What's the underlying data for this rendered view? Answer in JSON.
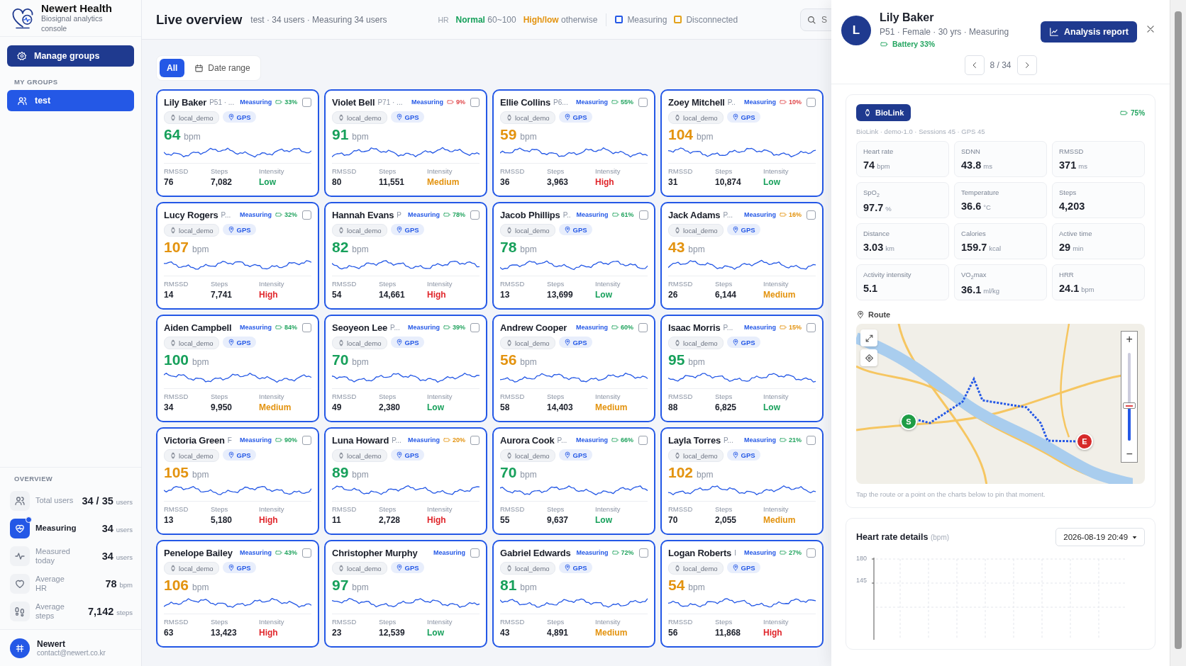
{
  "app": {
    "title": "Newert Health",
    "subtitle": "Biosignal analytics console"
  },
  "sidebar": {
    "manage_button": "Manage groups",
    "groups_heading": "MY GROUPS",
    "groups": [
      {
        "label": "test",
        "selected": true
      }
    ],
    "overview_heading": "OVERVIEW",
    "overview": [
      {
        "kind": "users",
        "label": "Total users",
        "value": "34 / 35",
        "unit": "users",
        "selected": false
      },
      {
        "kind": "measuring",
        "label": "Measuring",
        "value": "34",
        "unit": "users",
        "selected": true
      },
      {
        "kind": "pulse",
        "label": "Measured today",
        "value": "34",
        "unit": "users",
        "selected": false
      },
      {
        "kind": "heart",
        "label": "Average HR",
        "value": "78",
        "unit": "bpm",
        "selected": false
      },
      {
        "kind": "steps",
        "label": "Average steps",
        "value": "7,142",
        "unit": "steps",
        "selected": false
      }
    ],
    "account": {
      "name": "Newert",
      "email": "contact@newert.co.kr"
    }
  },
  "header": {
    "title": "Live overview",
    "summary": "test · 34 users · Measuring 34 users",
    "legend_label": "HR",
    "normal_label": "Normal",
    "normal_range": "60~100",
    "abnormal_label": "High/low",
    "abnormal_range": "otherwise",
    "status_legend": [
      {
        "label": "Measuring",
        "color": "#2458e6"
      },
      {
        "label": "Disconnected",
        "color": "#e3a21a"
      }
    ],
    "search": {
      "placeholder": "S"
    }
  },
  "filters": [
    {
      "kind": "all",
      "label": "All",
      "selected": true
    },
    {
      "kind": "date",
      "label": "Date range",
      "selected": false
    }
  ],
  "cards": [
    {
      "name": "Lily Baker",
      "meta": "P51 · ...",
      "status": "Measuring",
      "disconnected": false,
      "battery": {
        "label": "33%",
        "color": "#22a45f"
      },
      "checked": false,
      "device": "local_demo",
      "gps": "GPS",
      "bpm": "64",
      "bpm_unit": "bpm",
      "bpm_normal": true,
      "rmssd_label": "RMSSD",
      "rmssd": "76",
      "steps_label": "Steps",
      "steps": "7,082",
      "intensity_label": "Intensity",
      "intensity": {
        "label": "Low",
        "color": "#17a05b"
      }
    },
    {
      "name": "Violet Bell",
      "meta": "P71 · ...",
      "status": "Measuring",
      "disconnected": false,
      "battery": {
        "label": "9%",
        "color": "#e0474a"
      },
      "checked": false,
      "device": "local_demo",
      "gps": "GPS",
      "bpm": "91",
      "bpm_unit": "bpm",
      "bpm_normal": true,
      "rmssd_label": "RMSSD",
      "rmssd": "80",
      "steps_label": "Steps",
      "steps": "11,551",
      "intensity_label": "Intensity",
      "intensity": {
        "label": "Medium",
        "color": "#e3930f"
      }
    },
    {
      "name": "Ellie Collins",
      "meta": "P6...",
      "status": "Measuring",
      "disconnected": false,
      "battery": {
        "label": "55%",
        "color": "#22a45f"
      },
      "checked": false,
      "device": "local_demo",
      "gps": "GPS",
      "bpm": "59",
      "bpm_unit": "bpm",
      "bpm_normal": false,
      "rmssd_label": "RMSSD",
      "rmssd": "36",
      "steps_label": "Steps",
      "steps": "3,963",
      "intensity_label": "Intensity",
      "intensity": {
        "label": "High",
        "color": "#e0262b"
      }
    },
    {
      "name": "Zoey Mitchell",
      "meta": "P..",
      "status": "Measuring",
      "disconnected": false,
      "battery": {
        "label": "10%",
        "color": "#e0474a"
      },
      "checked": false,
      "device": "local_demo",
      "gps": "GPS",
      "bpm": "104",
      "bpm_unit": "bpm",
      "bpm_normal": false,
      "rmssd_label": "RMSSD",
      "rmssd": "31",
      "steps_label": "Steps",
      "steps": "10,874",
      "intensity_label": "Intensity",
      "intensity": {
        "label": "Low",
        "color": "#17a05b"
      }
    },
    {
      "name": "Lucy Rogers",
      "meta": "P...",
      "status": "Measuring",
      "disconnected": false,
      "battery": {
        "label": "32%",
        "color": "#22a45f"
      },
      "checked": false,
      "device": "local_demo",
      "gps": "GPS",
      "bpm": "107",
      "bpm_unit": "bpm",
      "bpm_normal": false,
      "rmssd_label": "RMSSD",
      "rmssd": "14",
      "steps_label": "Steps",
      "steps": "7,741",
      "intensity_label": "Intensity",
      "intensity": {
        "label": "High",
        "color": "#e0262b"
      }
    },
    {
      "name": "Hannah Evans",
      "meta": "P",
      "status": "Measuring",
      "disconnected": false,
      "battery": {
        "label": "78%",
        "color": "#22a45f"
      },
      "checked": false,
      "device": "local_demo",
      "gps": "GPS",
      "bpm": "82",
      "bpm_unit": "bpm",
      "bpm_normal": true,
      "rmssd_label": "RMSSD",
      "rmssd": "54",
      "steps_label": "Steps",
      "steps": "14,661",
      "intensity_label": "Intensity",
      "intensity": {
        "label": "High",
        "color": "#e0262b"
      }
    },
    {
      "name": "Jacob Phillips",
      "meta": "P..",
      "status": "Measuring",
      "disconnected": false,
      "battery": {
        "label": "61%",
        "color": "#22a45f"
      },
      "checked": false,
      "device": "local_demo",
      "gps": "GPS",
      "bpm": "78",
      "bpm_unit": "bpm",
      "bpm_normal": true,
      "rmssd_label": "RMSSD",
      "rmssd": "13",
      "steps_label": "Steps",
      "steps": "13,699",
      "intensity_label": "Intensity",
      "intensity": {
        "label": "Low",
        "color": "#17a05b"
      }
    },
    {
      "name": "Jack Adams",
      "meta": "P...",
      "status": "Measuring",
      "disconnected": false,
      "battery": {
        "label": "16%",
        "color": "#e3930f"
      },
      "checked": false,
      "device": "local_demo",
      "gps": "GPS",
      "bpm": "43",
      "bpm_unit": "bpm",
      "bpm_normal": false,
      "rmssd_label": "RMSSD",
      "rmssd": "26",
      "steps_label": "Steps",
      "steps": "6,144",
      "intensity_label": "Intensity",
      "intensity": {
        "label": "Medium",
        "color": "#e3930f"
      }
    },
    {
      "name": "Aiden Campbell",
      "status": "Measuring",
      "disconnected": false,
      "battery": {
        "label": "84%",
        "color": "#22a45f"
      },
      "checked": false,
      "device": "local_demo",
      "gps": "GPS",
      "bpm": "100",
      "bpm_unit": "bpm",
      "bpm_normal": true,
      "rmssd_label": "RMSSD",
      "rmssd": "34",
      "steps_label": "Steps",
      "steps": "9,950",
      "intensity_label": "Intensity",
      "intensity": {
        "label": "Medium",
        "color": "#e3930f"
      }
    },
    {
      "name": "Seoyeon Lee",
      "meta": "P...",
      "status": "Measuring",
      "disconnected": false,
      "battery": {
        "label": "39%",
        "color": "#22a45f"
      },
      "checked": false,
      "device": "local_demo",
      "gps": "GPS",
      "bpm": "70",
      "bpm_unit": "bpm",
      "bpm_normal": true,
      "rmssd_label": "RMSSD",
      "rmssd": "49",
      "steps_label": "Steps",
      "steps": "2,380",
      "intensity_label": "Intensity",
      "intensity": {
        "label": "Low",
        "color": "#17a05b"
      }
    },
    {
      "name": "Andrew Cooper",
      "status": "Measuring",
      "disconnected": false,
      "battery": {
        "label": "60%",
        "color": "#22a45f"
      },
      "checked": false,
      "device": "local_demo",
      "gps": "GPS",
      "bpm": "56",
      "bpm_unit": "bpm",
      "bpm_normal": false,
      "rmssd_label": "RMSSD",
      "rmssd": "58",
      "steps_label": "Steps",
      "steps": "14,403",
      "intensity_label": "Intensity",
      "intensity": {
        "label": "Medium",
        "color": "#e3930f"
      }
    },
    {
      "name": "Isaac Morris",
      "meta": "P...",
      "status": "Measuring",
      "disconnected": false,
      "battery": {
        "label": "15%",
        "color": "#e3930f"
      },
      "checked": false,
      "device": "local_demo",
      "gps": "GPS",
      "bpm": "95",
      "bpm_unit": "bpm",
      "bpm_normal": true,
      "rmssd_label": "RMSSD",
      "rmssd": "88",
      "steps_label": "Steps",
      "steps": "6,825",
      "intensity_label": "Intensity",
      "intensity": {
        "label": "Low",
        "color": "#17a05b"
      }
    },
    {
      "name": "Victoria Green",
      "meta": "F",
      "status": "Measuring",
      "disconnected": false,
      "battery": {
        "label": "90%",
        "color": "#22a45f"
      },
      "checked": false,
      "device": "local_demo",
      "gps": "GPS",
      "bpm": "105",
      "bpm_unit": "bpm",
      "bpm_normal": false,
      "rmssd_label": "RMSSD",
      "rmssd": "13",
      "steps_label": "Steps",
      "steps": "5,180",
      "intensity_label": "Intensity",
      "intensity": {
        "label": "High",
        "color": "#e0262b"
      }
    },
    {
      "name": "Luna Howard",
      "meta": "P...",
      "status": "Measuring",
      "disconnected": false,
      "battery": {
        "label": "20%",
        "color": "#e3930f"
      },
      "checked": false,
      "device": "local_demo",
      "gps": "GPS",
      "bpm": "89",
      "bpm_unit": "bpm",
      "bpm_normal": true,
      "rmssd_label": "RMSSD",
      "rmssd": "11",
      "steps_label": "Steps",
      "steps": "2,728",
      "intensity_label": "Intensity",
      "intensity": {
        "label": "High",
        "color": "#e0262b"
      }
    },
    {
      "name": "Aurora Cook",
      "meta": "P...",
      "status": "Measuring",
      "disconnected": false,
      "battery": {
        "label": "66%",
        "color": "#22a45f"
      },
      "checked": false,
      "device": "local_demo",
      "gps": "GPS",
      "bpm": "70",
      "bpm_unit": "bpm",
      "bpm_normal": true,
      "rmssd_label": "RMSSD",
      "rmssd": "55",
      "steps_label": "Steps",
      "steps": "9,637",
      "intensity_label": "Intensity",
      "intensity": {
        "label": "Low",
        "color": "#17a05b"
      }
    },
    {
      "name": "Layla Torres",
      "meta": "P...",
      "status": "Measuring",
      "disconnected": false,
      "battery": {
        "label": "21%",
        "color": "#22a45f"
      },
      "checked": false,
      "device": "local_demo",
      "gps": "GPS",
      "bpm": "102",
      "bpm_unit": "bpm",
      "bpm_normal": false,
      "rmssd_label": "RMSSD",
      "rmssd": "70",
      "steps_label": "Steps",
      "steps": "2,055",
      "intensity_label": "Intensity",
      "intensity": {
        "label": "Medium",
        "color": "#e3930f"
      }
    },
    {
      "name": "Penelope Bailey",
      "status": "Measuring",
      "disconnected": false,
      "battery": {
        "label": "43%",
        "color": "#22a45f"
      },
      "checked": false,
      "device": "local_demo",
      "gps": "GPS",
      "bpm": "106",
      "bpm_unit": "bpm",
      "bpm_normal": false,
      "rmssd_label": "RMSSD",
      "rmssd": "63",
      "steps_label": "Steps",
      "steps": "13,423",
      "intensity_label": "Intensity",
      "intensity": {
        "label": "High",
        "color": "#e0262b"
      }
    },
    {
      "name": "Christopher Murphy",
      "status": "Measuring",
      "disconnected": false,
      "checked": false,
      "device": "local_demo",
      "gps": "GPS",
      "bpm": "97",
      "bpm_unit": "bpm",
      "bpm_normal": true,
      "rmssd_label": "RMSSD",
      "rmssd": "23",
      "steps_label": "Steps",
      "steps": "12,539",
      "intensity_label": "Intensity",
      "intensity": {
        "label": "Low",
        "color": "#17a05b"
      }
    },
    {
      "name": "Gabriel Edwards",
      "status": "Measuring",
      "disconnected": false,
      "battery": {
        "label": "72%",
        "color": "#22a45f"
      },
      "checked": false,
      "device": "local_demo",
      "gps": "GPS",
      "bpm": "81",
      "bpm_unit": "bpm",
      "bpm_normal": true,
      "rmssd_label": "RMSSD",
      "rmssd": "43",
      "steps_label": "Steps",
      "steps": "4,891",
      "intensity_label": "Intensity",
      "intensity": {
        "label": "Medium",
        "color": "#e3930f"
      }
    },
    {
      "name": "Logan Roberts",
      "meta": "I",
      "status": "Measuring",
      "disconnected": false,
      "battery": {
        "label": "27%",
        "color": "#22a45f"
      },
      "checked": false,
      "device": "local_demo",
      "gps": "GPS",
      "bpm": "54",
      "bpm_unit": "bpm",
      "bpm_normal": false,
      "rmssd_label": "RMSSD",
      "rmssd": "56",
      "steps_label": "Steps",
      "steps": "11,868",
      "intensity_label": "Intensity",
      "intensity": {
        "label": "High",
        "color": "#e0262b"
      }
    }
  ],
  "detail": {
    "avatar": "L",
    "name": "Lily Baker",
    "info": "P51 · Female · 30 yrs · Measuring",
    "battery": "Battery 33%",
    "report_button": "Analysis report",
    "pager": "8 / 34",
    "device": {
      "name": "BioLink",
      "battery": "75%",
      "info": "BioLink · demo-1.0 · Sessions 45 · GPS 45",
      "metrics": [
        {
          "label": "Heart rate",
          "value": "74",
          "unit": "bpm"
        },
        {
          "label": "SDNN",
          "value": "43.8",
          "unit": "ms"
        },
        {
          "label": "RMSSD",
          "value": "371",
          "unit": "ms"
        },
        {
          "label": "SpO$_{2}$",
          "value": "97.7",
          "unit": "%"
        },
        {
          "label": "Temperature",
          "value": "36.6",
          "unit": "°C"
        },
        {
          "label": "Steps",
          "value": "4,203"
        },
        {
          "label": "Distance",
          "value": "3.03",
          "unit": "km"
        },
        {
          "label": "Calories",
          "value": "159.7",
          "unit": "kcal"
        },
        {
          "label": "Active time",
          "value": "29",
          "unit": "min"
        },
        {
          "label": "Activity intensity",
          "value": "5.1"
        },
        {
          "label": "VO$_{2}$max",
          "value": "36.1",
          "unit": "ml/kg"
        },
        {
          "label": "HRR",
          "value": "24.1",
          "unit": "bpm"
        }
      ]
    },
    "route": {
      "title": "Route",
      "zoom_in": "+",
      "zoom_out": "−",
      "zoom_slider": {
        "level": 0.4
      },
      "start_marker": "S",
      "end_marker": "E",
      "hint": "Tap the route or a point on the charts below to pin that moment."
    },
    "heart_rate": {
      "title": "Heart rate details",
      "unit": "(bpm)",
      "date": "2026-08-19 20:49",
      "y_ticks": [
        "180",
        "145"
      ]
    }
  }
}
